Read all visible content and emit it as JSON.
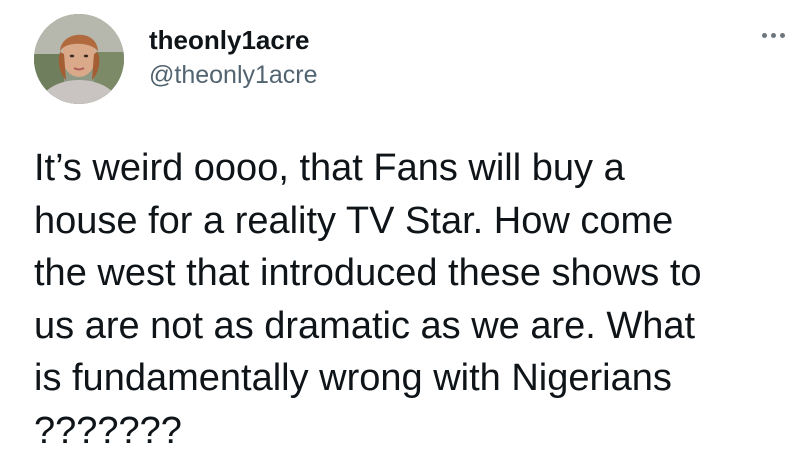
{
  "tweet": {
    "display_name": "theonly1acre",
    "handle": "@theonly1acre",
    "more_icon": "more-horizontal-icon",
    "avatar_icon": "profile-photo",
    "text_lines": [
      "It’s weird oooo, that Fans will buy a",
      "house for a reality TV Star. How come",
      "the west that introduced these shows to",
      "us are not as dramatic as we are. What",
      "is fundamentally wrong with Nigerians",
      "???????"
    ]
  },
  "colors": {
    "text": "#0f1419",
    "secondary": "#536471",
    "background": "#ffffff"
  }
}
